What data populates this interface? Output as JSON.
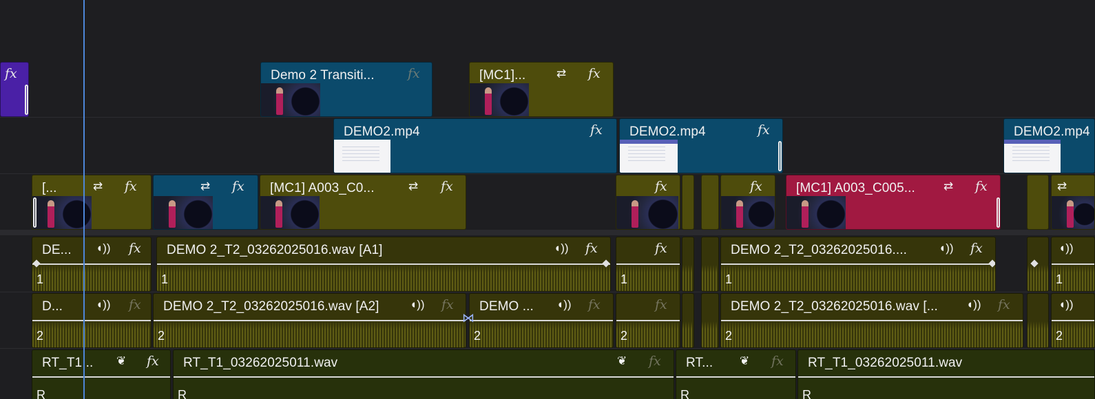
{
  "colors": {
    "background": "#1e1e21",
    "playhead": "#4d86d8",
    "video_yellow": "#4e4c0c",
    "video_blue": "#0b4a6b",
    "video_red": "#a11941",
    "video_purple": "#4a20a6",
    "audio_olive": "#36350a",
    "audio_rt": "#27310b"
  },
  "icons": {
    "fx": "fx",
    "sync": "⇄",
    "voice": "◖))",
    "leaf": "❦"
  },
  "tracks": {
    "v3": {
      "clips": [
        {
          "title": ""
        },
        {
          "title": "Demo 2 Transiti..."
        },
        {
          "title": "[MC1]..."
        }
      ]
    },
    "v2": {
      "clips": [
        {
          "title": "DEMO2.mp4"
        },
        {
          "title": "DEMO2.mp4"
        },
        {
          "title": "DEMO2.mp4"
        }
      ]
    },
    "v1": {
      "clips": [
        {
          "title": "[..."
        },
        {
          "title": ""
        },
        {
          "title": "[MC1] A003_C0..."
        },
        {
          "title": ""
        },
        {
          "title": ""
        },
        {
          "title": "[MC1] A003_C005..."
        }
      ]
    },
    "a1": {
      "clips": [
        {
          "title": "DE...",
          "ch": "1"
        },
        {
          "title": "DEMO 2_T2_03262025016.wav [A1]",
          "ch": "1"
        },
        {
          "title": "",
          "ch": "1"
        },
        {
          "title": "DEMO 2_T2_03262025016....",
          "ch": "1"
        },
        {
          "title": "",
          "ch": "1"
        }
      ]
    },
    "a2": {
      "clips": [
        {
          "title": "D...",
          "ch": "2"
        },
        {
          "title": "DEMO 2_T2_03262025016.wav [A2]",
          "ch": "2"
        },
        {
          "title": "DEMO ...",
          "ch": "2"
        },
        {
          "title": "",
          "ch": "2"
        },
        {
          "title": "DEMO 2_T2_03262025016.wav [...",
          "ch": "2"
        },
        {
          "title": "",
          "ch": "2"
        }
      ]
    },
    "a3": {
      "clips": [
        {
          "title": "RT_T1...",
          "ch": "R"
        },
        {
          "title": "RT_T1_03262025011.wav",
          "ch": "R"
        },
        {
          "title": "RT...",
          "ch": "R"
        },
        {
          "title": "RT_T1_03262025011.wav",
          "ch": "R"
        }
      ]
    }
  }
}
